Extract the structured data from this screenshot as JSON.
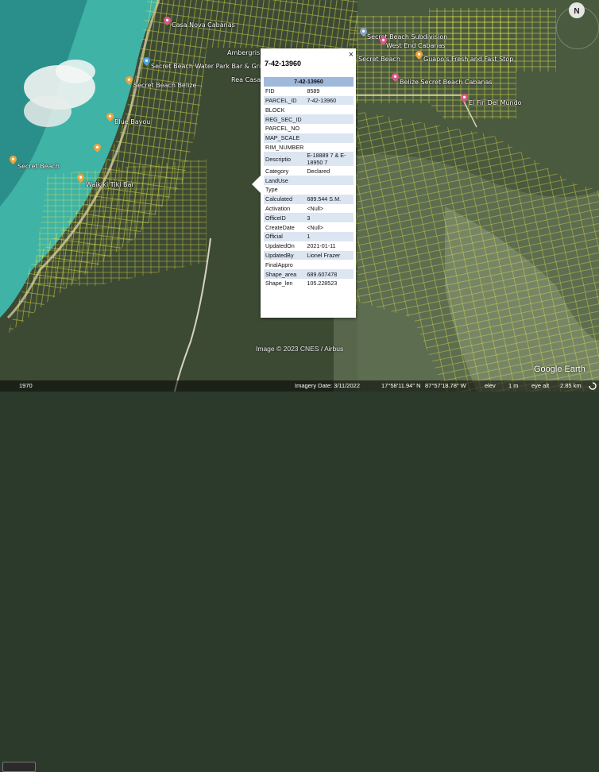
{
  "map": {
    "places": [
      {
        "label": "Casa Nova Cabanas"
      },
      {
        "label": "Ambergris Island Resort"
      },
      {
        "label": "Secret Beach Water Park Bar & Grill"
      },
      {
        "label": "Rea Casa"
      },
      {
        "label": "Secret Beach Belize"
      },
      {
        "label": "Blue Bayou"
      },
      {
        "label": "Secret Beach"
      },
      {
        "label": "Waikiki Tiki Bar"
      },
      {
        "label": "Secret Beach Subdivision"
      },
      {
        "label": "West End Cabanas"
      },
      {
        "label": "Guapo's Fresh and Fast Stop"
      },
      {
        "label": "Belize Secret Beach Cabanas"
      },
      {
        "label": "El Fin Del Mundo"
      },
      {
        "label": "Secret Beach"
      }
    ],
    "colors": {
      "parcel_lines": "#e8e84a",
      "water": "#3fb3a6",
      "land": "#3d4a33",
      "accent_pin": "#f0a33c"
    }
  },
  "popup": {
    "title": "7-42-13960",
    "close_label": "×",
    "table_header": "7-42-13960",
    "rows": [
      {
        "key": "FID",
        "value": "8589"
      },
      {
        "key": "PARCEL_ID",
        "value": "7-42-13960"
      },
      {
        "key": "BLOCK",
        "value": ""
      },
      {
        "key": "REG_SEC_ID",
        "value": ""
      },
      {
        "key": "PARCEL_NO",
        "value": ""
      },
      {
        "key": "MAP_SCALE",
        "value": ""
      },
      {
        "key": "RIM_NUMBER",
        "value": ""
      },
      {
        "key": "Descriptio",
        "value": "E-18889 7 & E-18950 7"
      },
      {
        "key": "Category",
        "value": "Declared"
      },
      {
        "key": "LandUse",
        "value": ""
      },
      {
        "key": "Type",
        "value": ""
      },
      {
        "key": "Calculated",
        "value": "689.544 S.M."
      },
      {
        "key": "Activation",
        "value": "<Null>"
      },
      {
        "key": "OfficeID",
        "value": "3"
      },
      {
        "key": "CreateDate",
        "value": "<Null>"
      },
      {
        "key": "Official",
        "value": "1"
      },
      {
        "key": "UpdatedOn",
        "value": "2021-01-11"
      },
      {
        "key": "UpdatedBy",
        "value": "Lionel Frazer"
      },
      {
        "key": "FinalAppro",
        "value": ""
      },
      {
        "key": "Shape_area",
        "value": "689.607478"
      },
      {
        "key": "Shape_len",
        "value": "105.228523"
      }
    ]
  },
  "overlay": {
    "copyright": "Image © 2023 CNES / Airbus",
    "logo": "Google Earth",
    "compass_label": "N"
  },
  "status": {
    "history_year": "1970",
    "imagery_date": "Imagery Date: 3/11/2022",
    "latitude": "17°58'11.94\" N",
    "longitude": "87°57'18.78\" W",
    "elev_label": "elev",
    "elev_value": "1 m",
    "eye_alt_label": "eye alt",
    "eye_alt_value": "2.85 km"
  }
}
